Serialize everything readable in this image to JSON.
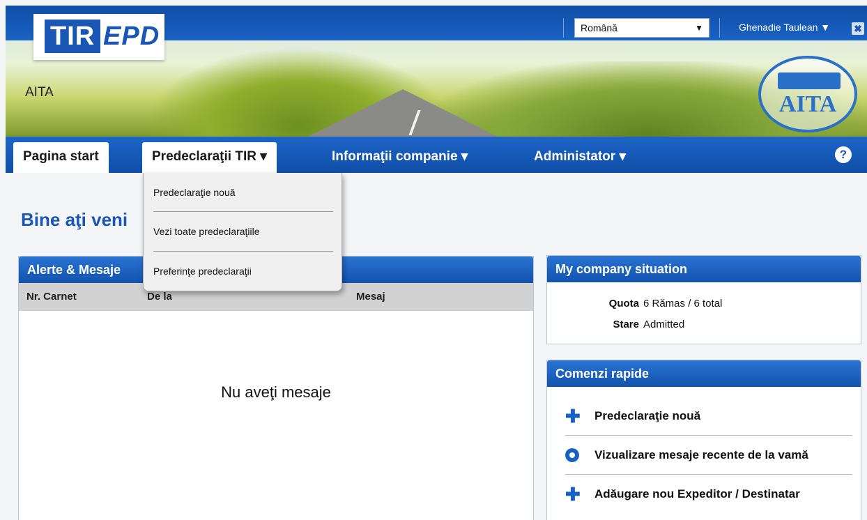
{
  "header": {
    "logo_tir": "TIR",
    "logo_epd": "EPD",
    "org_name": "AITA",
    "badge_text": "AITA",
    "language": "Română",
    "user": "Ghenadie Taulean ▼",
    "close": "✖"
  },
  "nav": {
    "home": "Pagina start",
    "predecl": "Predeclaraţii TIR ▾",
    "info": "Informaţii companie ▾",
    "admin": "Administator ▾",
    "help": "?"
  },
  "dropdown": {
    "items": [
      "Predeclaraţie nouă",
      "Vezi toate predeclaraţiile",
      "Preferinţe predeclaraţii"
    ]
  },
  "main": {
    "welcome": "Bine aţi veni                            R-EPD"
  },
  "alerts": {
    "title": "Alerte & Mesaje",
    "columns": [
      "Nr. Carnet",
      "De la",
      "Mesaj"
    ],
    "empty": "Nu aveţi mesaje"
  },
  "company": {
    "title": "My company situation",
    "quota_label": "Quota",
    "quota_value": "6 Rămas / 6 total",
    "stare_label": "Stare",
    "stare_value": "Admitted"
  },
  "quick": {
    "title": "Comenzi rapide",
    "items": [
      "Predeclaraţie nouă",
      "Vizualizare mesaje recente de la vamă",
      "Adăugare nou Expeditor / Destinatar"
    ]
  }
}
